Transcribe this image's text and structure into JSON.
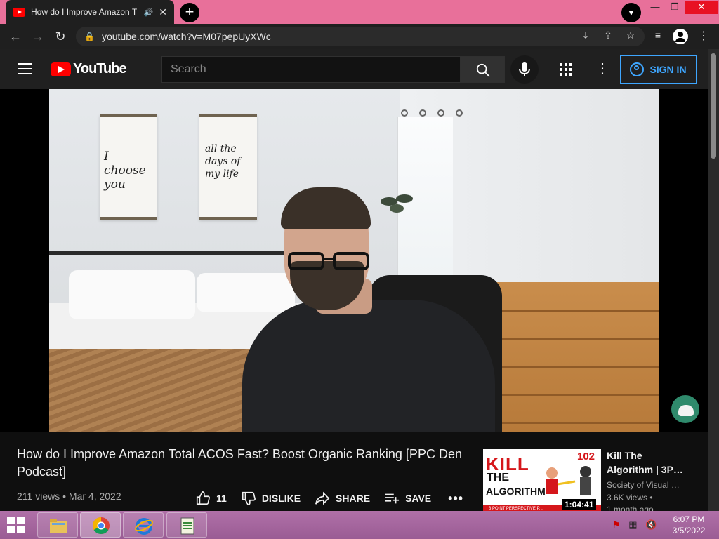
{
  "browser": {
    "tab_title": "How do I Improve Amazon T",
    "url": "youtube.com/watch?v=M07pepUyXWc",
    "window_controls": {
      "minimize": "—",
      "restore": "❐",
      "close": "✕"
    }
  },
  "youtube_header": {
    "logo_text": "YouTube",
    "search_placeholder": "Search",
    "signin_label": "SIGN IN"
  },
  "video": {
    "title": "How do I Improve Amazon Total ACOS Fast? Boost Organic Ranking [PPC Den Podcast]",
    "views": "211 views",
    "separator": "•",
    "date": "Mar 4, 2022",
    "like_count": "11",
    "dislike_label": "DISLIKE",
    "share_label": "SHARE",
    "save_label": "SAVE",
    "more_label": "•••",
    "poster_left_text": "I choose you",
    "poster_right_text": "all the days of my life"
  },
  "recommended": {
    "thumb_kill": "KILL",
    "thumb_the": "THE",
    "thumb_algorithm": "ALGORITHM",
    "thumb_number": "102",
    "thumb_band": "3 POINT PERSPECTIVE P...",
    "duration": "1:04:41",
    "title": "Kill The Algorithm | 3P…",
    "channel": "Society of Visual …",
    "views": "3.6K views •",
    "age": "1 month ago"
  },
  "taskbar": {
    "time": "6:07 PM",
    "date": "3/5/2022"
  },
  "colors": {
    "youtube_red": "#ff0000",
    "link_blue": "#3ea6ff",
    "tabstrip_pink": "#e8709a",
    "taskbar_purple": "#9a5c94"
  }
}
